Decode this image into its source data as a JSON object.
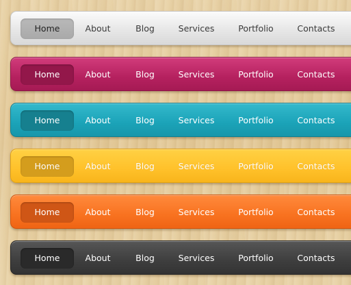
{
  "menus": [
    {
      "theme": "gray",
      "colors": {
        "bar": "#e7e7e7",
        "active": "#b1b1b1"
      },
      "items": [
        {
          "label": "Home",
          "active": true
        },
        {
          "label": "About"
        },
        {
          "label": "Blog"
        },
        {
          "label": "Services"
        },
        {
          "label": "Portfolio"
        },
        {
          "label": "Contacts"
        }
      ]
    },
    {
      "theme": "magenta",
      "colors": {
        "bar": "#b5215f",
        "active": "#93174a"
      },
      "items": [
        {
          "label": "Home",
          "active": true
        },
        {
          "label": "About"
        },
        {
          "label": "Blog"
        },
        {
          "label": "Services"
        },
        {
          "label": "Portfolio"
        },
        {
          "label": "Contacts"
        }
      ]
    },
    {
      "theme": "teal",
      "colors": {
        "bar": "#1ba3b8",
        "active": "#16808f"
      },
      "items": [
        {
          "label": "Home",
          "active": true
        },
        {
          "label": "About"
        },
        {
          "label": "Blog"
        },
        {
          "label": "Services"
        },
        {
          "label": "Portfolio"
        },
        {
          "label": "Contacts"
        }
      ]
    },
    {
      "theme": "yellow",
      "colors": {
        "bar": "#ffc12a",
        "active": "#d49d1d"
      },
      "items": [
        {
          "label": "Home",
          "active": true
        },
        {
          "label": "About"
        },
        {
          "label": "Blog"
        },
        {
          "label": "Services"
        },
        {
          "label": "Portfolio"
        },
        {
          "label": "Contacts"
        }
      ]
    },
    {
      "theme": "orange",
      "colors": {
        "bar": "#f87220",
        "active": "#cf5616"
      },
      "items": [
        {
          "label": "Home",
          "active": true
        },
        {
          "label": "About"
        },
        {
          "label": "Blog"
        },
        {
          "label": "Services"
        },
        {
          "label": "Portfolio"
        },
        {
          "label": "Contacts"
        }
      ]
    },
    {
      "theme": "dark",
      "colors": {
        "bar": "#3e3e3e",
        "active": "#2a2a2a"
      },
      "items": [
        {
          "label": "Home",
          "active": true
        },
        {
          "label": "About"
        },
        {
          "label": "Blog"
        },
        {
          "label": "Services"
        },
        {
          "label": "Portfolio"
        },
        {
          "label": "Contacts"
        }
      ]
    }
  ]
}
